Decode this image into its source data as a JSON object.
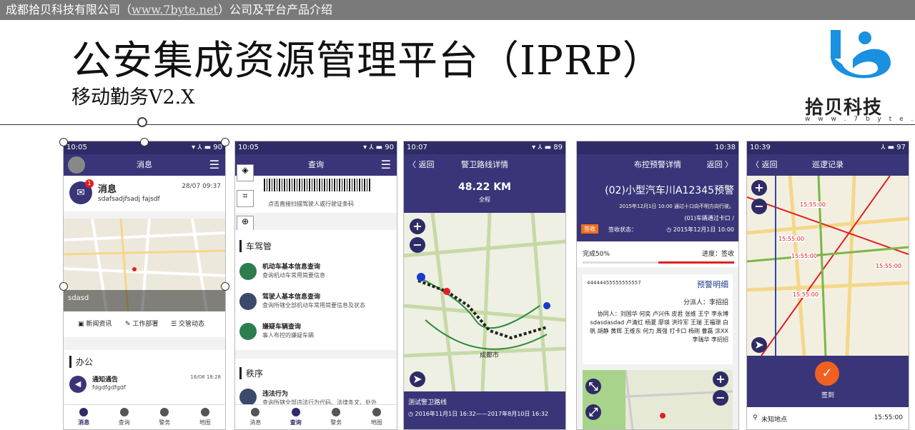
{
  "header": {
    "company": "成都拾贝科技有限公司（",
    "link": "www.7byte.net",
    "suffix": "）公司及平台产品介绍",
    "title": "公安集成资源管理平台（IPRP）",
    "subtitle": "移动勤务V2.X",
    "logo_cn": "拾贝科技",
    "logo_www": "w w w . 7 b y t e . n e t"
  },
  "colors": {
    "brand": "#2e2b66",
    "nav": "#3a3578",
    "logo_blue": "#1a90e0",
    "red": "#e02020"
  },
  "phone1": {
    "status_time": "10:05",
    "status_right": "▾ ⅄ ▬ 90",
    "nav_title": "消息",
    "msg_title": "消息",
    "msg_text": "sdafsadjfsadj fajsdf",
    "msg_date": "28/07 09:37",
    "badge": "1",
    "banner_text": "sdasd",
    "quick": [
      "新闻资讯",
      "工作部署",
      "交管动态"
    ],
    "section": "办公",
    "notice_title": "通知通告",
    "notice_text": "fdgdfgdfgdf",
    "notice_date": "16/08 18:28",
    "tabs": [
      "消息",
      "查询",
      "警务",
      "地图"
    ]
  },
  "phone2": {
    "status_time": "10:05",
    "status_right": "▾ ⅄ ▬ 90",
    "nav_title": "查询",
    "scan_hint": "点击直接扫描驾驶人或行驶证条码",
    "section1": "车驾管",
    "items": [
      {
        "title": "机动车基本信息查询",
        "desc": "查询机动车常用简要信息"
      },
      {
        "title": "驾驶人基本信息查询",
        "desc": "查询所辖全部机动车常用简要信息及状态"
      },
      {
        "title": "嫌疑车辆查询",
        "desc": "事人布控的嫌疑车辆"
      }
    ],
    "section2": "秩序",
    "item4_title": "违法行为",
    "item4_desc": "查询所辖全部违法行为代码、法律条文、处外",
    "tabs": [
      "消息",
      "查询",
      "警务",
      "地图"
    ]
  },
  "phone3": {
    "status_time": "10:07",
    "status_right": "▾ ⅄ ▬ 89",
    "back": "〈 返回",
    "nav_title": "警卫路线详情",
    "distance": "48.22 KM",
    "distance_label": "全程",
    "city": "成都市",
    "route_name": "测试警卫路线",
    "route_time": "◷ 2016年11月1日 16:32——2017年8月10日 16:32"
  },
  "phone4": {
    "status_time": "10:38",
    "nav_title": "布控预警详情",
    "back": "返回 〉",
    "plate": "(02)小型汽车川A12345预警",
    "warn_line": "2015年12月1日 10:00 通过十口向不明方向行驶。",
    "pass_info": "(01)车辆通过卡口 /",
    "time_line": "◷ 2015年12月1日 10:00",
    "status_label": "签收状态：",
    "status_val": "签收",
    "progress_label": "进度：签收",
    "progress_val": "完成50%",
    "detail_title": "预警明细",
    "detail_code": "44444455555555557",
    "assign_label": "分派人：李招招",
    "names": "协同人：刘国华 何奕 卢兴伟 皮君 张维 王宁 李永博 sdasdasdad 卢清红 杨夏 廖瑛 洪玲军 王瑞 王福璟 白帆 胡静 黄辉 王维东 何力 周强 打卡口 杨刚 曹磊 涂XX 李瑞华 李招招"
  },
  "phone5": {
    "status_time": "10:39",
    "status_right": "⅄ ▬ 97",
    "back": "〈 返回",
    "nav_title": "巡逻记录",
    "times": [
      "15:55:00",
      "15:55:00",
      "15:55:00",
      "15:55:00",
      "15:55:00"
    ],
    "checkin": "签到",
    "location": "未知地点",
    "loc_time": "15:55:00"
  }
}
